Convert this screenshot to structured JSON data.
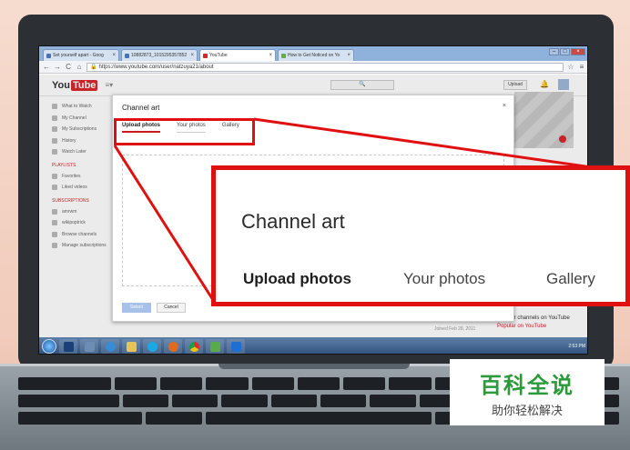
{
  "browser": {
    "tabs": [
      {
        "title": "Set yourself apart - Goog",
        "favicon": "google-icon"
      },
      {
        "title": "10882873_1015295357852",
        "favicon": "facebook-icon"
      },
      {
        "title": "YouTube",
        "favicon": "youtube-icon"
      },
      {
        "title": "How to Get Noticed on Yo",
        "favicon": "wikihow-icon"
      }
    ],
    "url": "https://www.youtube.com/user/natzuya21/about"
  },
  "youtube": {
    "logo_you": "You",
    "logo_tube": "Tube",
    "upload_label": "Upload",
    "sidebar": {
      "items": [
        "What to Watch",
        "My Channel",
        "My Subscriptions",
        "History",
        "Watch Later"
      ],
      "playlists_heading": "PLAYLISTS",
      "playlists": [
        "Favorites",
        "Liked videos"
      ],
      "subscriptions_heading": "SUBSCRIPTIONS",
      "subscriptions": [
        "amrwm",
        "wikipoptrick"
      ],
      "footer": [
        "Browse channels",
        "Manage subscriptions"
      ]
    },
    "joined": "Joined Feb 28, 2011",
    "popular_heading": "Popular channels on YouTube",
    "popular_item": "Popular on YouTube"
  },
  "modal": {
    "title": "Channel art",
    "close": "×",
    "tabs": [
      "Upload photos",
      "Your photos",
      "Gallery"
    ],
    "select_label": "Select",
    "cancel_label": "Cancel"
  },
  "zoom": {
    "title": "Channel art",
    "tabs": [
      "Upload photos",
      "Your photos",
      "Gallery"
    ]
  },
  "taskbar": {
    "clock": "2:53 PM"
  },
  "watermark": {
    "line1": "百科全说",
    "line2": "助你轻松解决"
  },
  "colors": {
    "highlight": "#e01010",
    "youtube_red": "#d9262c",
    "watermark_green": "#2a9a3a"
  }
}
